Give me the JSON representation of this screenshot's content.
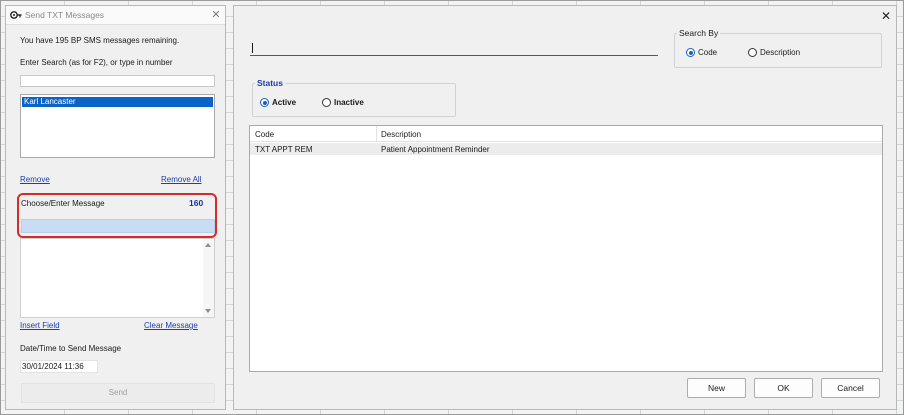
{
  "left_window": {
    "title": "Send TXT Messages",
    "remaining_text": "You have 195 BP SMS messages remaining.",
    "search_label": "Enter Search (as for F2), or type in number",
    "search_value": "",
    "recipients": [
      "Karl Lancaster"
    ],
    "remove_label": "Remove",
    "remove_all_label": "Remove All",
    "choose_message_label": "Choose/Enter Message",
    "char_count": "160",
    "message_value": "",
    "insert_field_label": "Insert Field",
    "clear_message_label": "Clear Message",
    "datetime_label": "Date/Time to Send Message",
    "datetime_value": "30/01/2024 11:36",
    "send_label": "Send"
  },
  "right_window": {
    "search_value": "",
    "search_by": {
      "legend": "Search By",
      "options": [
        "Code",
        "Description"
      ],
      "selected": "Code"
    },
    "status": {
      "legend": "Status",
      "options": [
        "Active",
        "Inactive"
      ],
      "selected": "Active"
    },
    "table": {
      "columns": [
        "Code",
        "Description"
      ],
      "rows": [
        {
          "code": "TXT APPT REM",
          "description": "Patient Appointment Reminder"
        }
      ]
    },
    "buttons": {
      "new": "New",
      "ok": "OK",
      "cancel": "Cancel"
    }
  },
  "colors": {
    "accent_blue": "#1a5fc0",
    "selection_blue": "#0a63c9",
    "highlight_red": "#d62b2b",
    "link_blue": "#1a3fb0",
    "count_blue": "#1a2fa0"
  },
  "icons": {
    "app_icon": "key-icon",
    "close_icon": "close-icon",
    "scroll_up": "scroll-up-arrow-icon",
    "scroll_down": "scroll-down-arrow-icon"
  }
}
